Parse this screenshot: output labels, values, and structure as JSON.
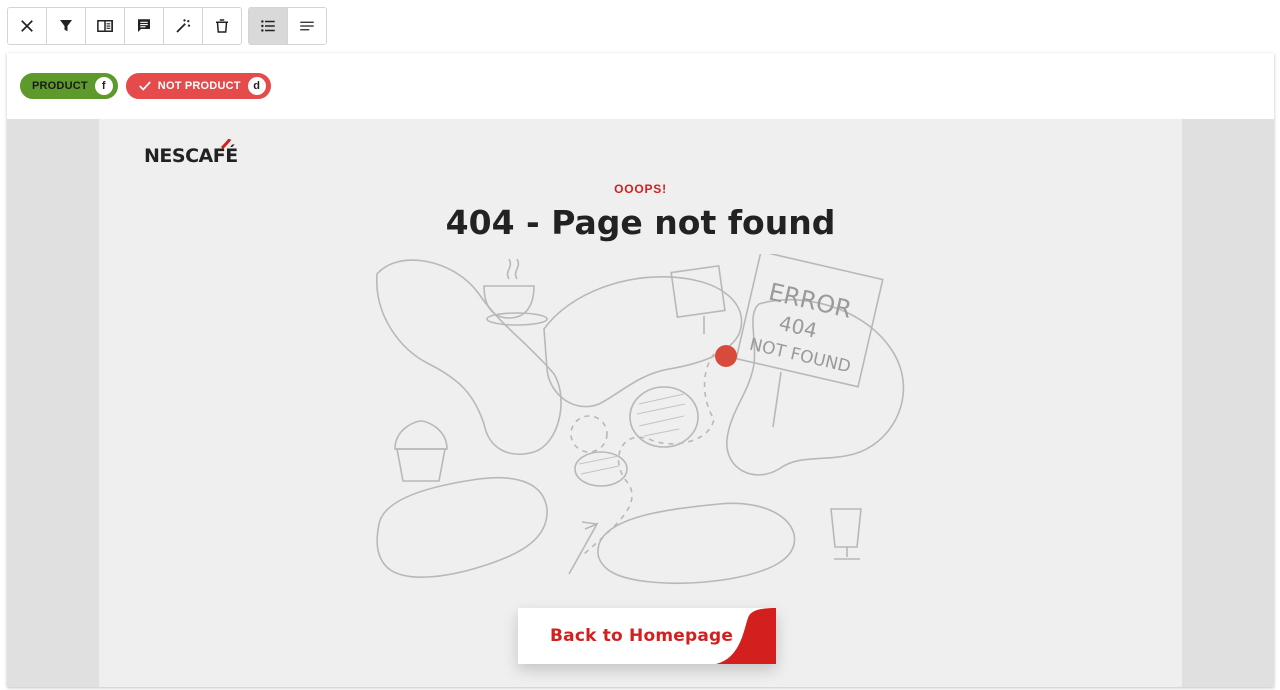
{
  "toolbar": {
    "buttons": [
      {
        "icon": "close-icon"
      },
      {
        "icon": "filter-icon"
      },
      {
        "icon": "side-panel-icon"
      },
      {
        "icon": "comment-icon"
      },
      {
        "icon": "magic-wand-icon"
      },
      {
        "icon": "trash-icon"
      }
    ],
    "view_buttons": [
      {
        "icon": "list-view-icon",
        "active": true
      },
      {
        "icon": "text-view-icon",
        "active": false
      }
    ]
  },
  "labels": {
    "product": {
      "label": "PRODUCT",
      "key": "f",
      "color": "#5e9a2b"
    },
    "not_product": {
      "label": "NOT PRODUCT",
      "key": "d",
      "color": "#e64b4b",
      "selected": true
    }
  },
  "page": {
    "brand": "NESCAFÉ",
    "eyebrow": "OOOPS!",
    "heading": "404 - Page not found",
    "sign_text": [
      "ERROR",
      "404",
      "NOT FOUND"
    ],
    "cta_label": "Back to Homepage",
    "accent_color": "#d41f1f"
  }
}
